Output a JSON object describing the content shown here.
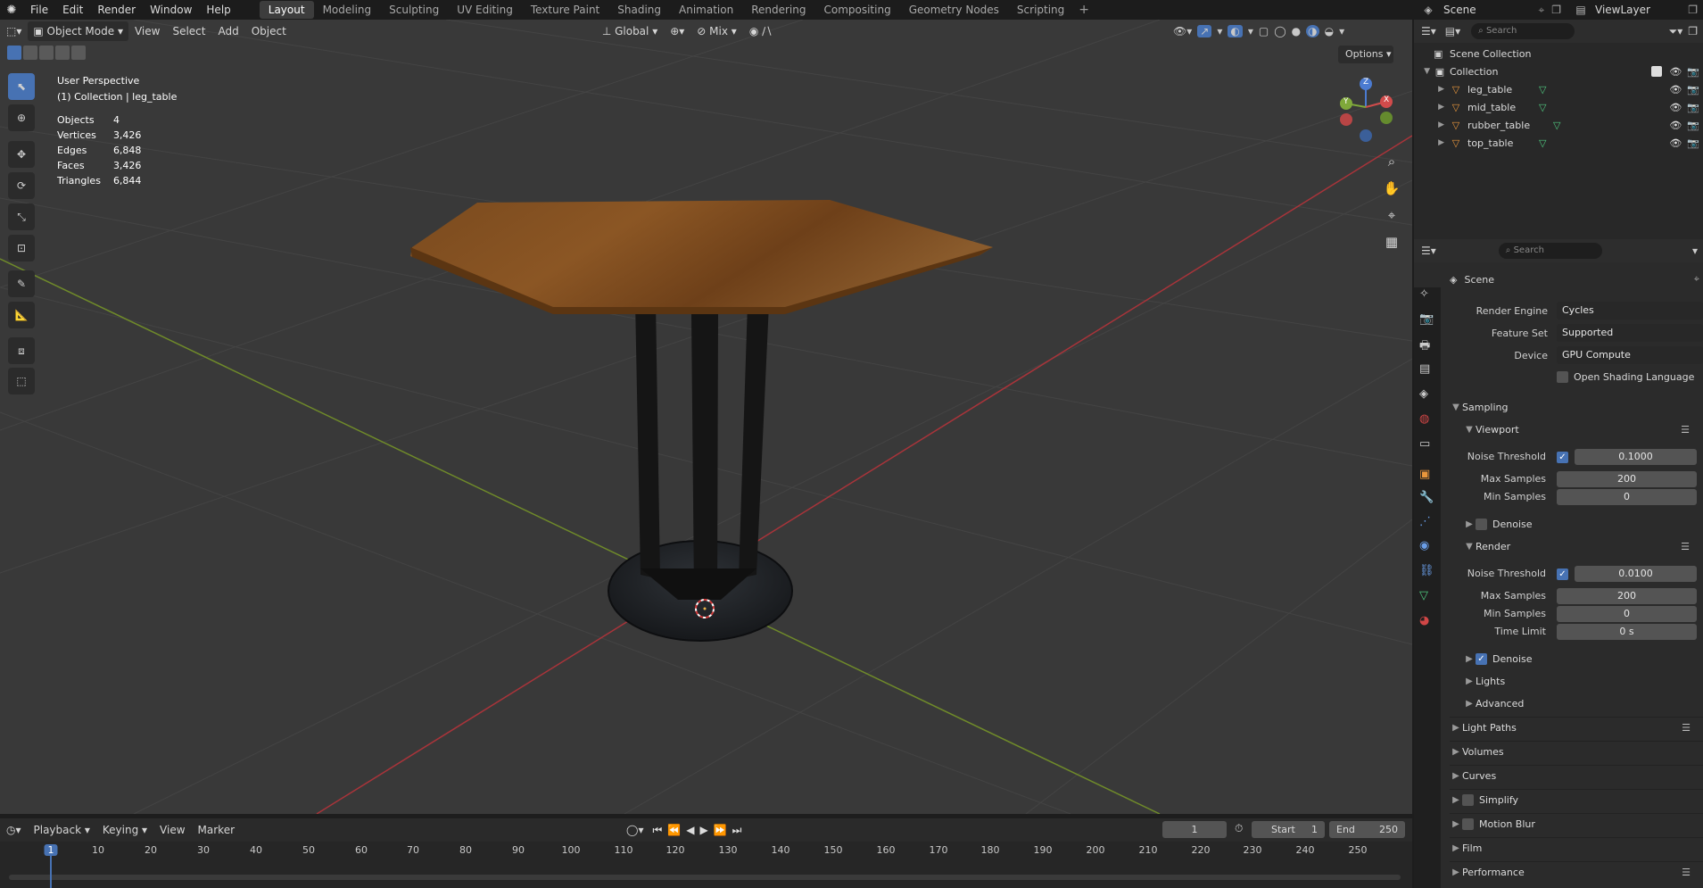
{
  "topbar": {
    "menus": [
      "File",
      "Edit",
      "Render",
      "Window",
      "Help"
    ],
    "workspaces": [
      "Layout",
      "Modeling",
      "Sculpting",
      "UV Editing",
      "Texture Paint",
      "Shading",
      "Animation",
      "Rendering",
      "Compositing",
      "Geometry Nodes",
      "Scripting"
    ],
    "active_workspace": "Layout",
    "scene_name": "Scene",
    "view_layer": "ViewLayer"
  },
  "viewport_header": {
    "mode": "Object Mode",
    "menus": [
      "View",
      "Select",
      "Add",
      "Object"
    ],
    "orientation": "Global",
    "snap": "Mix",
    "options_label": "Options"
  },
  "overlay": {
    "title": "User Perspective",
    "subtitle": "(1) Collection | leg_table",
    "stats": [
      {
        "label": "Objects",
        "value": "4"
      },
      {
        "label": "Vertices",
        "value": "3,426"
      },
      {
        "label": "Edges",
        "value": "6,848"
      },
      {
        "label": "Faces",
        "value": "3,426"
      },
      {
        "label": "Triangles",
        "value": "6,844"
      }
    ]
  },
  "gizmo": {
    "x": "X",
    "y": "Y",
    "z": "Z"
  },
  "outliner": {
    "search_placeholder": "Search",
    "scene_collection": "Scene Collection",
    "collection": "Collection",
    "objects": [
      "leg_table",
      "mid_table",
      "rubber_table",
      "top_table"
    ]
  },
  "properties": {
    "search_placeholder": "Search",
    "context": "Scene",
    "render_engine_label": "Render Engine",
    "render_engine": "Cycles",
    "feature_set_label": "Feature Set",
    "feature_set": "Supported",
    "device_label": "Device",
    "device": "GPU Compute",
    "osl_label": "Open Shading Language",
    "sampling": "Sampling",
    "viewport": "Viewport",
    "render": "Render",
    "noise_threshold_label": "Noise Threshold",
    "max_samples_label": "Max Samples",
    "min_samples_label": "Min Samples",
    "time_limit_label": "Time Limit",
    "vp_noise_threshold": "0.1000",
    "vp_max_samples": "200",
    "vp_min_samples": "0",
    "denoise_label": "Denoise",
    "r_noise_threshold": "0.0100",
    "r_max_samples": "200",
    "r_min_samples": "0",
    "r_time_limit": "0 s",
    "lights": "Lights",
    "advanced": "Advanced",
    "panels": [
      "Light Paths",
      "Volumes",
      "Curves",
      "Simplify",
      "Motion Blur",
      "Film",
      "Performance"
    ]
  },
  "timeline": {
    "menus": [
      "Playback",
      "Keying",
      "View",
      "Marker"
    ],
    "current_frame": "1",
    "start_label": "Start",
    "start": "1",
    "end_label": "End",
    "end": "250",
    "ticks": [
      "1",
      "10",
      "20",
      "30",
      "40",
      "50",
      "60",
      "70",
      "80",
      "90",
      "100",
      "110",
      "120",
      "130",
      "140",
      "150",
      "160",
      "170",
      "180",
      "190",
      "200",
      "210",
      "220",
      "230",
      "240",
      "250"
    ]
  }
}
